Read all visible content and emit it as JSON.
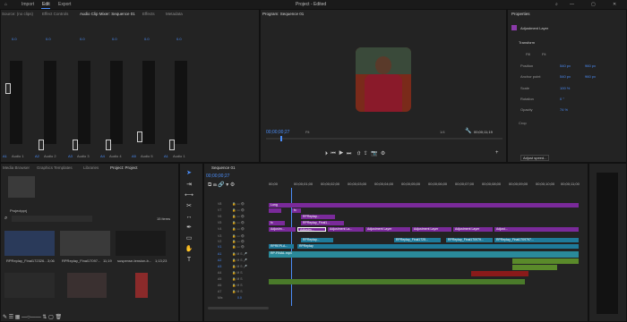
{
  "menu": {
    "items": [
      "Import",
      "Edit",
      "Export"
    ],
    "window_title": "Project - Edited"
  },
  "source_panel": {
    "tabs": [
      "Source: (no clips)",
      "Effect Controls",
      "Audio Clip Mixer: Sequence 01",
      "Effects",
      "Metadata"
    ],
    "channels": [
      {
        "label": "A1",
        "name": "Audio 1",
        "value": "0.0"
      },
      {
        "label": "A2",
        "name": "Audio 2",
        "value": "0.0"
      },
      {
        "label": "A3",
        "name": "Audio 3",
        "value": "0.0"
      },
      {
        "label": "A4",
        "name": "Audio 4",
        "value": "0.0"
      },
      {
        "label": "A5",
        "name": "Audio 5",
        "value": "0.0"
      },
      {
        "label": "A1",
        "name": "Audio 1",
        "value": "0.0"
      }
    ]
  },
  "program": {
    "title": "Program: Sequence 01",
    "timecode": "00;00;00;27",
    "fit": "Fit",
    "quality": "1/4",
    "duration": "00;00;11;19"
  },
  "properties": {
    "title": "Properties",
    "layer": "Adjustment Layer",
    "section": "Transform",
    "fill_label": "Fill",
    "fit_label": "Fit",
    "position_label": "Position",
    "position_x": "540 px",
    "position_y": "960 px",
    "anchor_label": "Anchor point",
    "anchor_x": "540 px",
    "anchor_y": "960 px",
    "scale_label": "Scale",
    "scale_value": "100 %",
    "rotation_label": "Rotation",
    "rotation_value": "0 °",
    "opacity_label": "Opacity",
    "opacity_value": "74 %",
    "crop_label": "Crop",
    "adjust_speed": "Adjust speed..."
  },
  "project_panel": {
    "tabs": [
      "Media Browser",
      "Graphics Templates",
      "Libraries",
      "Project: Project"
    ],
    "folder": "Projectpprj",
    "items_count": "15 items",
    "clips": [
      {
        "name": "RPReplay_Final172326...",
        "dur": "3;06"
      },
      {
        "name": "RPReplay_Final17097...",
        "dur": "11;19"
      },
      {
        "name": "suspense-tension-b...",
        "dur": "1;13;23"
      }
    ]
  },
  "sequence": {
    "tab": "Sequence 01",
    "timecode": "00;00;00;27",
    "ruler": [
      "00;00",
      "00;00;01;00",
      "00;00;02;00",
      "00;00;03;00",
      "00;00;04;00",
      "00;00;05;00",
      "00;00;06;00",
      "00;00;07;00",
      "00;00;08;00",
      "00;00;09;00",
      "00;00;10;00",
      "00;00;11;00"
    ],
    "tracks": [
      "V8",
      "V7",
      "V6",
      "V5",
      "V4",
      "V3",
      "V2",
      "V1",
      "A1",
      "A2",
      "A3",
      "A4",
      "A5",
      "A6",
      "A7",
      "Mix"
    ],
    "mix_value": "0.0",
    "clips": {
      "lung": "Lung",
      "fx": "fx",
      "rp1": "RPReplay...",
      "rp2": "RPReplay_Final1...",
      "adj1": "Adjustm...",
      "adj2": "Adjustment La...",
      "adj3": "Adjustment Layer",
      "adj4": "Adjustment Layer",
      "adj5": "Adjustment Layer",
      "adj6": "Adjust...",
      "v2a": "RPReplay...",
      "v2b": "RPReplay_Final1725...",
      "v2c": "RPReplay_Final170979...",
      "v2d": "RPReplay_Final1709797...",
      "v1a": "RPREPLA...",
      "v1b": "RPReplay",
      "a1": "RP-FINAL.mp4"
    }
  },
  "colors": {
    "accent": "#4b8df8",
    "purple": "#8a3aa8",
    "teal": "#1f8a9a",
    "green": "#5a8a2a",
    "red": "#8a1a1a"
  }
}
